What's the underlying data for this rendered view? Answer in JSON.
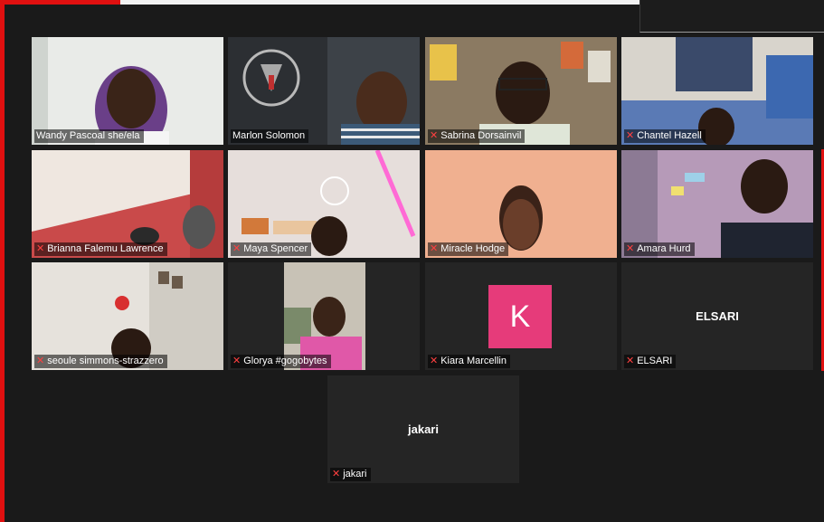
{
  "participants": [
    {
      "name": "Wandy Pascoal she/ela",
      "muted": false,
      "active": true
    },
    {
      "name": "Marlon Solomon",
      "muted": false,
      "active": false
    },
    {
      "name": "Sabrina Dorsainvil",
      "muted": true,
      "active": false
    },
    {
      "name": "Chantel Hazell",
      "muted": true,
      "active": false
    },
    {
      "name": "Brianna Falemu Lawrence",
      "muted": true,
      "active": false
    },
    {
      "name": "Maya Spencer",
      "muted": true,
      "active": false
    },
    {
      "name": "Miracle Hodge",
      "muted": true,
      "active": false
    },
    {
      "name": "Amara Hurd",
      "muted": true,
      "active": false
    },
    {
      "name": "seoule simmons-strazzero",
      "muted": true,
      "active": false
    },
    {
      "name": "Glorya #gogobytes",
      "muted": true,
      "active": false
    },
    {
      "name": "Kiara Marcellin",
      "muted": true,
      "active": false,
      "initial": "K",
      "avatar_color": "#e63b7a"
    },
    {
      "name": "ELSARI",
      "muted": true,
      "active": false,
      "display_text": "ELSARI"
    },
    {
      "name": "jakari",
      "muted": true,
      "active": false,
      "display_text": "jakari"
    }
  ],
  "icons": {
    "muted": "mic-muted-icon"
  },
  "colors": {
    "active_speaker": "#c5e84a",
    "recording_bar": "#e01010",
    "muted_icon": "#ff4040"
  }
}
